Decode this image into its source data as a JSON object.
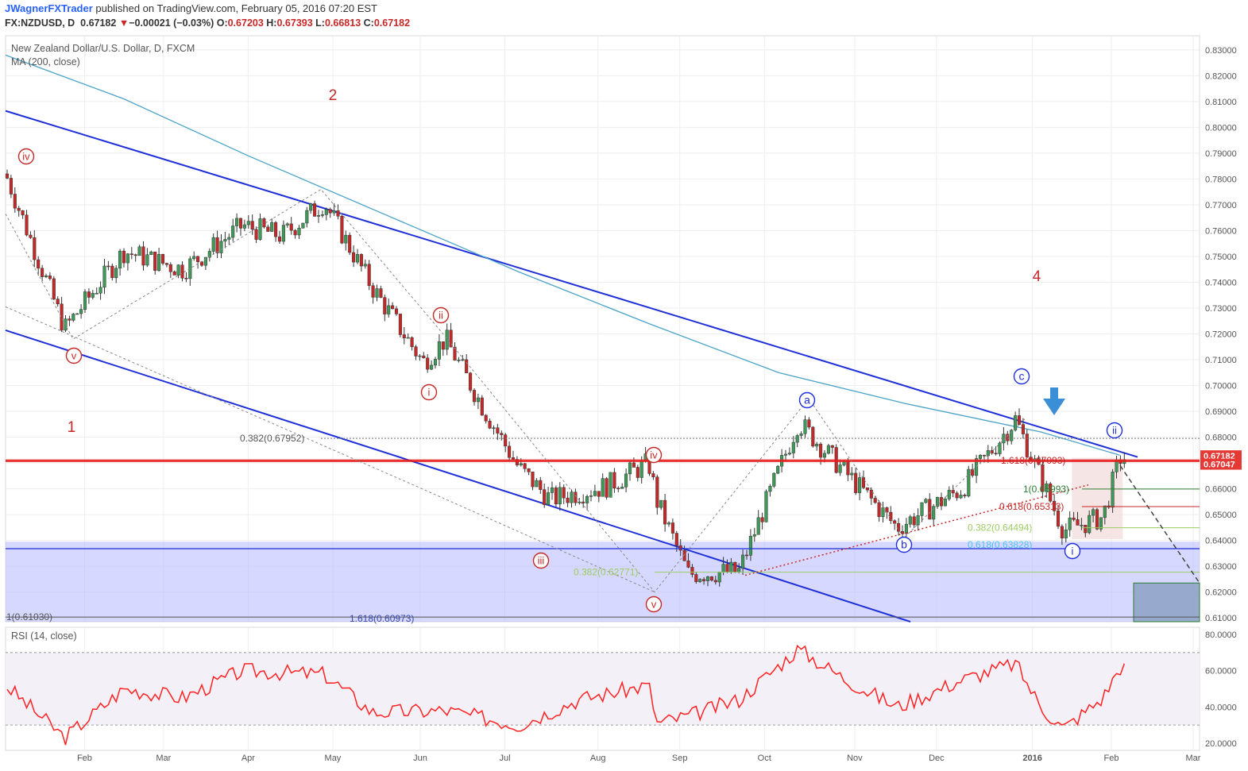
{
  "header": {
    "author": "JWagnerFXTrader",
    "published": "published on TradingView.com, February 05, 2016 07:20 EST",
    "symbol": "FX:NZDUSD, D",
    "last": "0.67182",
    "change": "−0.00021 (−0.03%)",
    "ohlc": [
      {
        "label": "O:",
        "value": "0.67203"
      },
      {
        "label": "H:",
        "value": "0.67393"
      },
      {
        "label": "L:",
        "value": "0.66813"
      },
      {
        "label": "C:",
        "value": "0.67182"
      }
    ]
  },
  "chart_data": {
    "type": "line",
    "title": "New Zealand Dollar/U.S. Dollar, D, FXCM",
    "indicator": "MA (200, close)",
    "ylim": [
      0.6085,
      0.8355
    ],
    "y_ticks": [
      "0.61000",
      "0.62000",
      "0.63000",
      "0.64000",
      "0.65000",
      "0.66000",
      "0.67000",
      "0.68000",
      "0.69000",
      "0.70000",
      "0.71000",
      "0.72000",
      "0.73000",
      "0.74000",
      "0.75000",
      "0.76000",
      "0.77000",
      "0.78000",
      "0.79000",
      "0.80000",
      "0.81000",
      "0.82000",
      "0.83000"
    ],
    "x_labels": [
      "Feb",
      "Mar",
      "Apr",
      "May",
      "Jun",
      "Jul",
      "Aug",
      "Sep",
      "Oct",
      "Nov",
      "Dec",
      "2016",
      "Feb",
      "Mar"
    ],
    "price_tags": [
      {
        "value": 0.67182,
        "label": "0.67182",
        "color": "#e53935"
      },
      {
        "value": 0.67047,
        "label": "0.67047",
        "color": "#e53935"
      }
    ],
    "series": [
      {
        "name": "NZDUSD",
        "style": "candles",
        "x": [
          "2015-01-05",
          "2015-01-26",
          "2015-02-16",
          "2015-03-09",
          "2015-03-30",
          "2015-04-13",
          "2015-04-28",
          "2015-05-15",
          "2015-06-02",
          "2015-06-10",
          "2015-06-24",
          "2015-07-06",
          "2015-07-17",
          "2015-08-06",
          "2015-08-21",
          "2015-08-24",
          "2015-09-04",
          "2015-09-22",
          "2015-10-13",
          "2015-10-30",
          "2015-11-17",
          "2015-12-10",
          "2015-12-29",
          "2016-01-07",
          "2016-01-15",
          "2016-01-29",
          "2016-02-04"
        ],
        "values": [
          0.782,
          0.722,
          0.752,
          0.745,
          0.762,
          0.758,
          0.771,
          0.738,
          0.709,
          0.718,
          0.69,
          0.668,
          0.656,
          0.661,
          0.67,
          0.655,
          0.627,
          0.628,
          0.686,
          0.666,
          0.645,
          0.66,
          0.687,
          0.664,
          0.644,
          0.649,
          0.672
        ]
      },
      {
        "name": "MA (200, close)",
        "style": "line",
        "x": [
          "2015-01-05",
          "2015-02-16",
          "2015-04-01",
          "2015-05-20",
          "2015-07-06",
          "2015-08-21",
          "2015-10-06",
          "2015-11-20",
          "2016-01-07",
          "2016-02-04"
        ],
        "values": [
          0.828,
          0.811,
          0.789,
          0.766,
          0.744,
          0.724,
          0.705,
          0.693,
          0.682,
          0.673
        ]
      }
    ],
    "oscillator": {
      "name": "RSI (14, close)",
      "ylim": [
        16,
        84
      ],
      "y_ticks": [
        "20.0000",
        "40.0000",
        "60.0000",
        "80.0000"
      ],
      "bands": [
        30,
        70
      ],
      "x": [
        "2015-01-05",
        "2015-01-26",
        "2015-02-16",
        "2015-03-09",
        "2015-03-30",
        "2015-04-28",
        "2015-05-15",
        "2015-06-10",
        "2015-07-06",
        "2015-07-27",
        "2015-08-21",
        "2015-08-24",
        "2015-09-04",
        "2015-09-22",
        "2015-10-13",
        "2015-10-30",
        "2015-11-17",
        "2015-12-10",
        "2015-12-29",
        "2016-01-07",
        "2016-01-15",
        "2016-01-29",
        "2016-02-04"
      ],
      "values": [
        52,
        23,
        50,
        45,
        60,
        58,
        37,
        38,
        30,
        44,
        52,
        31,
        35,
        44,
        72,
        55,
        40,
        55,
        64,
        40,
        28,
        45,
        62
      ]
    },
    "annotations": {
      "wave_labels_big": [
        "1",
        "2",
        "4"
      ],
      "wave_labels_roman": [
        "iv",
        "v",
        "ii",
        "i",
        "iii",
        "iv",
        "v",
        "i",
        "ii"
      ],
      "wave_labels_abc": [
        "a",
        "b",
        "c"
      ],
      "fib_texts": [
        "0.382(0.67952)",
        "1(0.61030)",
        "1.618(0.60973)",
        "0.382(0.62771)",
        "1.618(0.67093)",
        "1(0.65993)",
        "0.618(0.65313)",
        "0.382(0.64494)",
        "0.618(0.63828)"
      ]
    }
  },
  "colors": {
    "channel": "#1f2fd8",
    "ma": "#4aa3c7",
    "level": "#e51e1e",
    "bull": "#3e9a57",
    "bear": "#c62828",
    "rsi": "#ff2222",
    "wave_red": "#c62828",
    "wave_blue": "#1f2fd8"
  }
}
